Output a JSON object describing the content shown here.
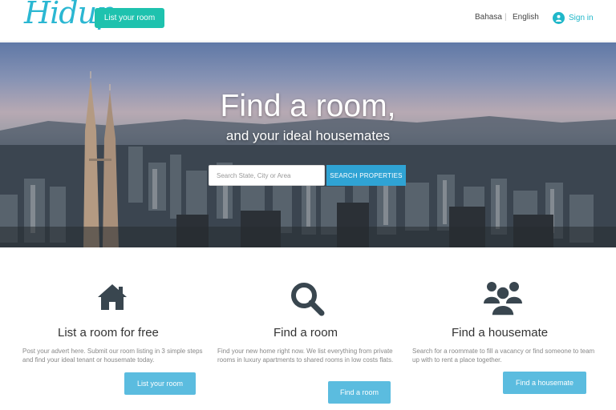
{
  "header": {
    "logo": "Hidup",
    "list_room_label": "List your room",
    "lang_bahasa": "Bahasa",
    "lang_separator": "|",
    "lang_english": "English",
    "sign_in_label": "Sign in",
    "accent_color": "#1ec2ae",
    "link_color": "#20b7c9"
  },
  "hero": {
    "title": "Find a room,",
    "subtitle": "and your ideal housemates",
    "search_placeholder": "Search State, City or Area",
    "search_button_label": "SEARCH PROPERTIES"
  },
  "features": [
    {
      "icon": "house-icon",
      "title": "List a room for free",
      "description": "Post your advert here. Submit our room listing in 3 simple steps  and find your ideal tenant or housemate today.",
      "button_label": "List your room"
    },
    {
      "icon": "search-icon",
      "title": "Find a room",
      "description": "Find your new home right now. We list everything from private rooms in luxury apartments to shared rooms in low costs flats.",
      "button_label": "Find a room"
    },
    {
      "icon": "users-icon",
      "title": "Find a housemate",
      "description": "Search for a roommate to fill a vacancy or find someone to team up with to rent a place together.",
      "button_label": "Find a housemate"
    }
  ]
}
